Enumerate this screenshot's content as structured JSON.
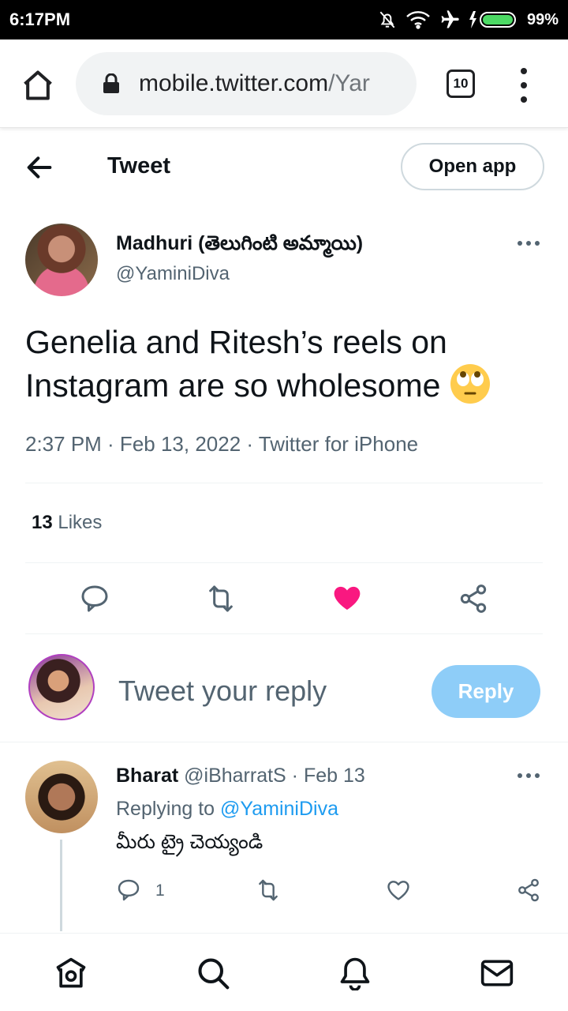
{
  "status_bar": {
    "time": "6:17PM",
    "battery": "99%"
  },
  "browser": {
    "url_host": "mobile.twitter.com",
    "url_path": "/Yar",
    "tab_count": "10"
  },
  "header": {
    "title": "Tweet",
    "open_app_label": "Open app"
  },
  "tweet": {
    "author_name": "Madhuri (తెలుగింటి అమ్మాయి)",
    "author_handle": "@YaminiDiva",
    "text": "Genelia and Ritesh’s reels on Instagram are so wholesome",
    "emoji_icon": "face-with-rolling-eyes-emoji",
    "meta": "2:37 PM · Feb 13, 2022 · Twitter for iPhone",
    "likes_count": "13",
    "likes_label": " Likes",
    "liked": true,
    "like_color": "#f91880"
  },
  "reply_box": {
    "placeholder": "Tweet your reply",
    "button_label": "Reply",
    "button_color": "#8ecdf8"
  },
  "reply": {
    "author_name": "Bharat",
    "author_handle": "@iBharratS",
    "date": " · Feb 13",
    "replying_to_label": "Replying to ",
    "replying_to_handle": "@YaminiDiva",
    "text": "మీరు ట్రై చెయ్యండి",
    "reply_count": "1"
  },
  "bottom_nav": {
    "items": [
      "home-icon",
      "search-icon",
      "notifications-icon",
      "messages-icon"
    ]
  }
}
